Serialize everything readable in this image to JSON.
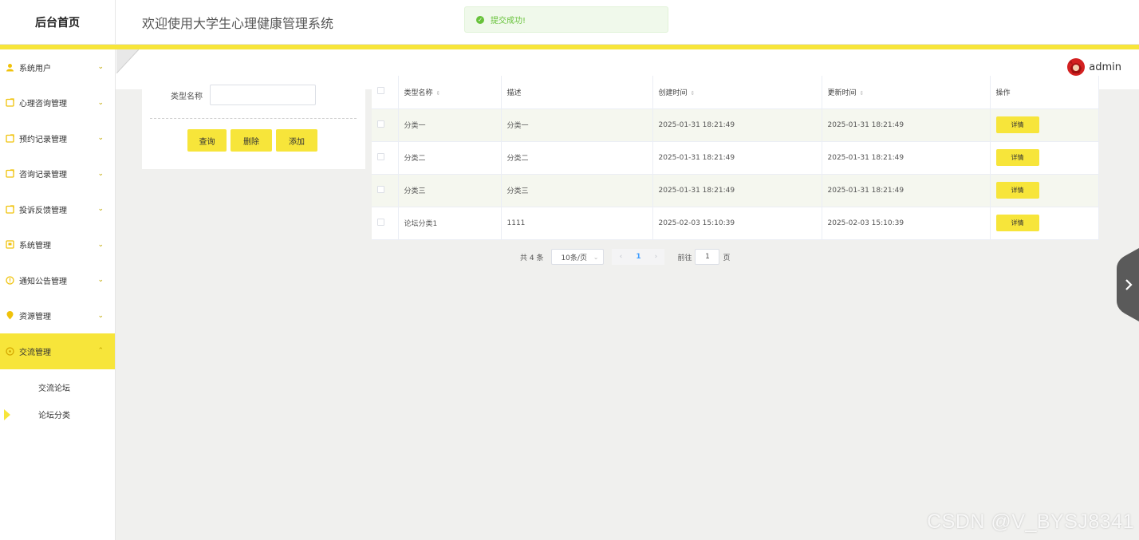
{
  "topbar": {
    "logo": "后台首页",
    "title": "欢迎使用大学生心理健康管理系统"
  },
  "toast": {
    "message": "提交成功!"
  },
  "user": {
    "name": "admin"
  },
  "sidebar": {
    "items": [
      {
        "label": "系统用户",
        "icon": "user-icon",
        "chevron": "⌄"
      },
      {
        "label": "心理咨询管理",
        "icon": "folder-icon",
        "chevron": "⌄"
      },
      {
        "label": "预约记录管理",
        "icon": "folder-icon",
        "chevron": "⌄"
      },
      {
        "label": "咨询记录管理",
        "icon": "folder-icon",
        "chevron": "⌄"
      },
      {
        "label": "投诉反馈管理",
        "icon": "folder-icon",
        "chevron": "⌄"
      },
      {
        "label": "系统管理",
        "icon": "settings-icon",
        "chevron": "⌄"
      },
      {
        "label": "通知公告管理",
        "icon": "info-icon",
        "chevron": "⌄"
      },
      {
        "label": "资源管理",
        "icon": "location-icon",
        "chevron": "⌄"
      },
      {
        "label": "交流管理",
        "icon": "chat-icon",
        "chevron": "⌃",
        "active": true
      }
    ],
    "subitems": [
      {
        "label": "交流论坛"
      },
      {
        "label": "论坛分类",
        "current": true
      }
    ]
  },
  "search": {
    "label": "类型名称",
    "value": "",
    "query_label": "查询",
    "delete_label": "删除",
    "add_label": "添加"
  },
  "table": {
    "headers": [
      "类型名称",
      "描述",
      "创建时间",
      "更新时间",
      "操作"
    ],
    "rows": [
      {
        "name": "分类一",
        "desc": "分类一",
        "created": "2025-01-31 18:21:49",
        "updated": "2025-01-31 18:21:49",
        "action": "详情"
      },
      {
        "name": "分类二",
        "desc": "分类二",
        "created": "2025-01-31 18:21:49",
        "updated": "2025-01-31 18:21:49",
        "action": "详情"
      },
      {
        "name": "分类三",
        "desc": "分类三",
        "created": "2025-01-31 18:21:49",
        "updated": "2025-01-31 18:21:49",
        "action": "详情"
      },
      {
        "name": "论坛分类1",
        "desc": "1111",
        "created": "2025-02-03 15:10:39",
        "updated": "2025-02-03 15:10:39",
        "action": "详情"
      }
    ]
  },
  "pagination": {
    "total": "共 4 条",
    "page_size": "10条/页",
    "prev": "‹",
    "current": "1",
    "next": "›",
    "goto_label": "前往",
    "goto_value": "1",
    "page_unit": "页"
  },
  "watermark": "CSDN @V_BYSJ8341",
  "colors": {
    "accent": "#f7e53a",
    "toast_bg": "#f0f9eb",
    "toast_text": "#67c23a"
  }
}
